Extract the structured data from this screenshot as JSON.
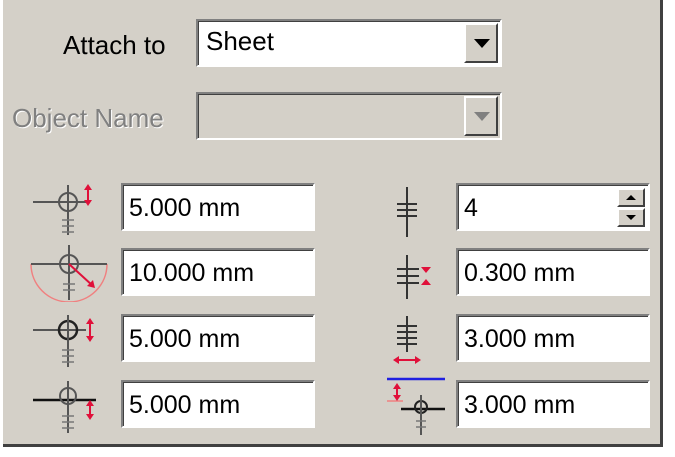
{
  "attach": {
    "label": "Attach to",
    "value": "Sheet"
  },
  "object_name": {
    "label": "Object Name",
    "value": ""
  },
  "left_fields": [
    {
      "icon": "thread-size-icon",
      "value": "5.000 mm"
    },
    {
      "icon": "rotation-radius-icon",
      "value": "10.000 mm"
    },
    {
      "icon": "thread-spacing-icon",
      "value": "5.000 mm"
    },
    {
      "icon": "thread-extension-icon",
      "value": "5.000 mm"
    }
  ],
  "right_fields": [
    {
      "icon": "line-count-icon",
      "value": "4"
    },
    {
      "icon": "line-gap-icon",
      "value": "0.300 mm"
    },
    {
      "icon": "line-width-icon",
      "value": "3.000 mm"
    },
    {
      "icon": "line-offset-icon",
      "value": "3.000 mm"
    }
  ],
  "colors": {
    "panel": "#d4d0c8",
    "accent_red": "#e0103a",
    "accent_blue": "#2020e0"
  }
}
